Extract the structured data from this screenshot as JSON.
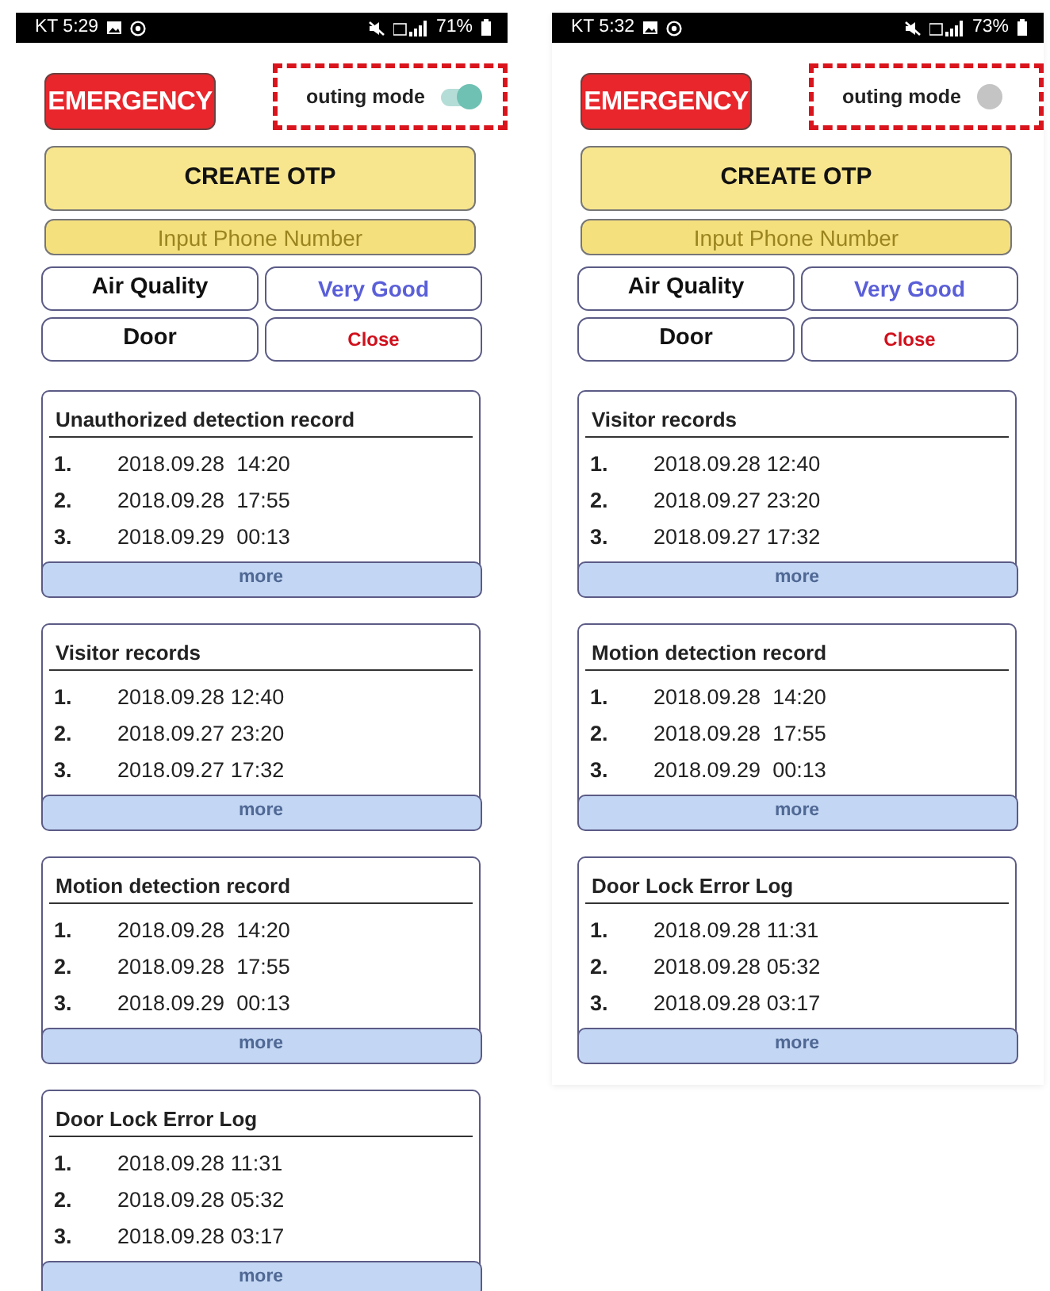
{
  "phones": [
    {
      "status_bar": {
        "carrier_time": "KT 5:29",
        "battery": "71%"
      },
      "emergency_button": "EMERGENCY",
      "outing_mode": {
        "label": "outing mode",
        "on": true
      },
      "create_otp_button": "CREATE OTP",
      "phone_input": {
        "placeholder": "Input Phone Number"
      },
      "status_rows": [
        {
          "label": "Air Quality",
          "value": "Very Good",
          "color": "#5a5fd8"
        },
        {
          "label": "Door",
          "value": "Close",
          "color": "#d0101c"
        }
      ],
      "records": [
        {
          "title": "Unauthorized detection record",
          "entries": [
            {
              "index": "1.",
              "time": "2018.09.28  14:20"
            },
            {
              "index": "2.",
              "time": "2018.09.28  17:55"
            },
            {
              "index": "3.",
              "time": "2018.09.29  00:13"
            }
          ],
          "more": "more"
        },
        {
          "title": "Visitor records",
          "entries": [
            {
              "index": "1.",
              "time": "2018.09.28 12:40"
            },
            {
              "index": "2.",
              "time": "2018.09.27 23:20"
            },
            {
              "index": "3.",
              "time": "2018.09.27 17:32"
            }
          ],
          "more": "more"
        },
        {
          "title": "Motion detection record",
          "entries": [
            {
              "index": "1.",
              "time": "2018.09.28  14:20"
            },
            {
              "index": "2.",
              "time": "2018.09.28  17:55"
            },
            {
              "index": "3.",
              "time": "2018.09.29  00:13"
            }
          ],
          "more": "more"
        },
        {
          "title": "Door Lock Error Log",
          "entries": [
            {
              "index": "1.",
              "time": "2018.09.28 11:31"
            },
            {
              "index": "2.",
              "time": "2018.09.28 05:32"
            },
            {
              "index": "3.",
              "time": "2018.09.28 03:17"
            }
          ],
          "more": "more"
        }
      ]
    },
    {
      "status_bar": {
        "carrier_time": "KT 5:32",
        "battery": "73%"
      },
      "emergency_button": "EMERGENCY",
      "outing_mode": {
        "label": "outing mode",
        "on": false
      },
      "create_otp_button": "CREATE OTP",
      "phone_input": {
        "placeholder": "Input Phone Number"
      },
      "status_rows": [
        {
          "label": "Air Quality",
          "value": "Very Good",
          "color": "#5a5fd8"
        },
        {
          "label": "Door",
          "value": "Close",
          "color": "#d0101c"
        }
      ],
      "records": [
        {
          "title": "Visitor records",
          "entries": [
            {
              "index": "1.",
              "time": "2018.09.28 12:40"
            },
            {
              "index": "2.",
              "time": "2018.09.27 23:20"
            },
            {
              "index": "3.",
              "time": "2018.09.27 17:32"
            }
          ],
          "more": "more"
        },
        {
          "title": "Motion detection record",
          "entries": [
            {
              "index": "1.",
              "time": "2018.09.28  14:20"
            },
            {
              "index": "2.",
              "time": "2018.09.28  17:55"
            },
            {
              "index": "3.",
              "time": "2018.09.29  00:13"
            }
          ],
          "more": "more"
        },
        {
          "title": "Door Lock Error Log",
          "entries": [
            {
              "index": "1.",
              "time": "2018.09.28 11:31"
            },
            {
              "index": "2.",
              "time": "2018.09.28 05:32"
            },
            {
              "index": "3.",
              "time": "2018.09.28 03:17"
            }
          ],
          "more": "more"
        }
      ]
    }
  ]
}
